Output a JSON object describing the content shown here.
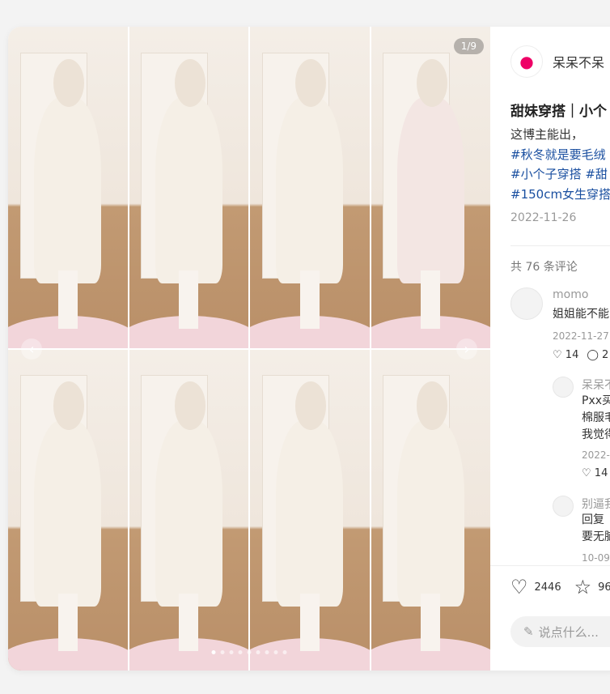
{
  "post": {
    "image_counter": "1/9",
    "author": "呆呆不呆",
    "title": "甜妹穿搭｜小个",
    "desc_lines": [
      "这博主能出，",
      "#秋冬就是要毛绒",
      "#小个子穿搭 #甜",
      "#150cm女生穿搭"
    ],
    "date": "2022-11-26",
    "comment_count": "共 76 条评论"
  },
  "comments": [
    {
      "name": "momo",
      "text": "姐姐能不能",
      "date": "2022-11-27",
      "likes": "14",
      "replies": "2"
    },
    {
      "name": "呆呆不",
      "lines": [
        "Pxx买",
        "棉服毛",
        "我觉得"
      ],
      "date": "2022-",
      "likes": "14"
    },
    {
      "name": "别逼我",
      "lines": [
        "回复",
        "要无脑"
      ],
      "date": "10-09"
    }
  ],
  "footer": {
    "likes": "2446",
    "stars": "96",
    "input_placeholder": "说点什么..."
  },
  "icons": {
    "arrow_left": "chevron-left-icon",
    "arrow_right": "chevron-right-icon",
    "like": "heart-icon",
    "star": "star-icon",
    "reply": "comment-icon",
    "pen": "pencil-icon"
  },
  "colors": {
    "tag": "#1a4fa0",
    "rug": "#f2d5da",
    "floor": "#b98f68"
  }
}
